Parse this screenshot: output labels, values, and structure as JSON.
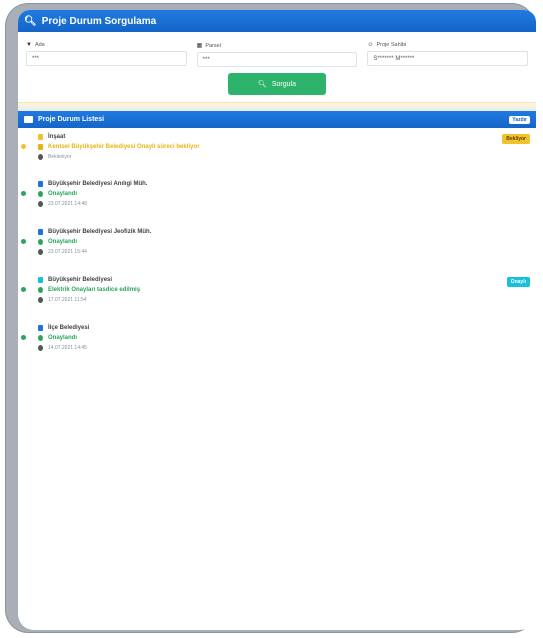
{
  "header": {
    "title": "Proje Durum Sorgulama"
  },
  "filters": [
    {
      "label": "Ada",
      "value": "***",
      "icon": "map-pin-icon"
    },
    {
      "label": "Parsel",
      "value": "***",
      "icon": "grid-icon"
    },
    {
      "label": "Proje Sahibi",
      "value": "S******* M******",
      "icon": "user-icon"
    }
  ],
  "search_button": "Sorgula",
  "list": {
    "title": "Proje Durum Listesi",
    "export_label": "Yazdır"
  },
  "items": [
    {
      "title": "İnşaat",
      "status": "Kentsel Büyükşehir Belediyesi Onaylı süreci bekliyor",
      "date": "Bekleniyor",
      "tag": "Bekliyor",
      "color": "#f2c12e",
      "status_color": "#e8b410",
      "icon_color": "#f2c12e"
    },
    {
      "title": "Büyükşehir Belediyesi Anılıgi Müh.",
      "status": "Onaylandı",
      "date": "23.07.2021 14:48",
      "tag": "",
      "color": "#2aa55a",
      "status_color": "#2aa55a",
      "icon_color": "#1f73d8"
    },
    {
      "title": "Büyükşehir Belediyesi Jeofizik Müh.",
      "status": "Onaylandı",
      "date": "23.07.2021 15:44",
      "tag": "",
      "color": "#2aa55a",
      "status_color": "#2aa55a",
      "icon_color": "#1f73d8"
    },
    {
      "title": "Büyükşehir Belediyesi",
      "status": "Elektrik Onayları tasdice edilmiş",
      "date": "17.07.2021 11:54",
      "tag": "Onaylı",
      "color": "#2aa55a",
      "status_color": "#2aa55a",
      "icon_color": "#17c1dc"
    },
    {
      "title": "İlçe Belediyesi",
      "status": "Onaylandı",
      "date": "14.07.2021 14:45",
      "tag": "",
      "color": "#2aa55a",
      "status_color": "#2aa55a",
      "icon_color": "#1f73d8"
    }
  ]
}
